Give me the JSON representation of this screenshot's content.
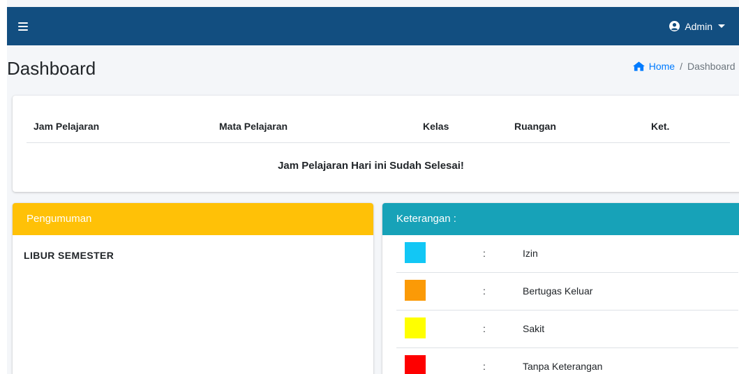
{
  "navbar": {
    "user_label": "Admin",
    "bg_color": "#124e80"
  },
  "header": {
    "title": "Dashboard",
    "breadcrumb": {
      "home": "Home",
      "separator": "/",
      "current": "Dashboard"
    }
  },
  "schedule": {
    "columns": [
      "Jam Pelajaran",
      "Mata Pelajaran",
      "Kelas",
      "Ruangan",
      "Ket."
    ],
    "empty_message": "Jam Pelajaran Hari ini Sudah Selesai!"
  },
  "announcement": {
    "title": "Pengumuman",
    "header_color": "#ffc107",
    "content": "LIBUR SEMESTER"
  },
  "legend": {
    "title": "Keterangan :",
    "header_color": "#17a2b8",
    "items": [
      {
        "color": "#12c7f5",
        "separator": ":",
        "label": "Izin"
      },
      {
        "color": "#fb9a06",
        "separator": ":",
        "label": "Bertugas Keluar"
      },
      {
        "color": "#ffff00",
        "separator": ":",
        "label": "Sakit"
      },
      {
        "color": "#fe0000",
        "separator": ":",
        "label": "Tanpa Keterangan"
      }
    ]
  },
  "icons": {
    "menu": "hamburger-menu-icon",
    "user": "user-circle-icon",
    "dropdown": "caret-down-icon",
    "home": "home-icon"
  }
}
